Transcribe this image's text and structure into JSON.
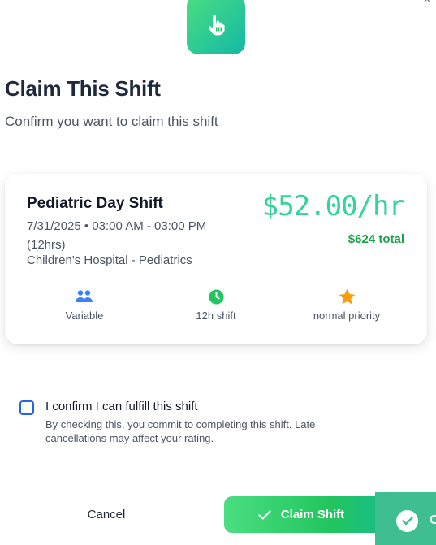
{
  "header": {
    "title": "Claim This Shift",
    "subtitle": "Confirm you want to claim this shift",
    "icon": "pointer-hand-icon"
  },
  "shift": {
    "name": "Pediatric Day Shift",
    "when": "7/31/2025 • 03:00 AM - 03:00 PM (12hrs)",
    "where": "Children's Hospital - Pediatrics",
    "rate": "$52.00/hr",
    "total": "$624 total",
    "stats": [
      {
        "icon": "users-icon",
        "label": "Variable"
      },
      {
        "icon": "clock-icon",
        "label": "12h shift"
      },
      {
        "icon": "star-icon",
        "label": "normal priority"
      }
    ]
  },
  "confirm": {
    "label": "I confirm I can fulfill this shift",
    "hint": "By checking this, you commit to completing this shift. Late cancellations may affect your rating.",
    "checked": false
  },
  "actions": {
    "cancel_label": "Cancel",
    "claim_label": "Claim Shift"
  },
  "toast": {
    "text": "C",
    "icon": "check-circle-icon"
  },
  "colors": {
    "accent_green": "#22c55e",
    "accent_teal": "#14b8a6",
    "rate_color": "#34d399",
    "total_color": "#16a34a",
    "checkbox_blue": "#2563eb"
  }
}
